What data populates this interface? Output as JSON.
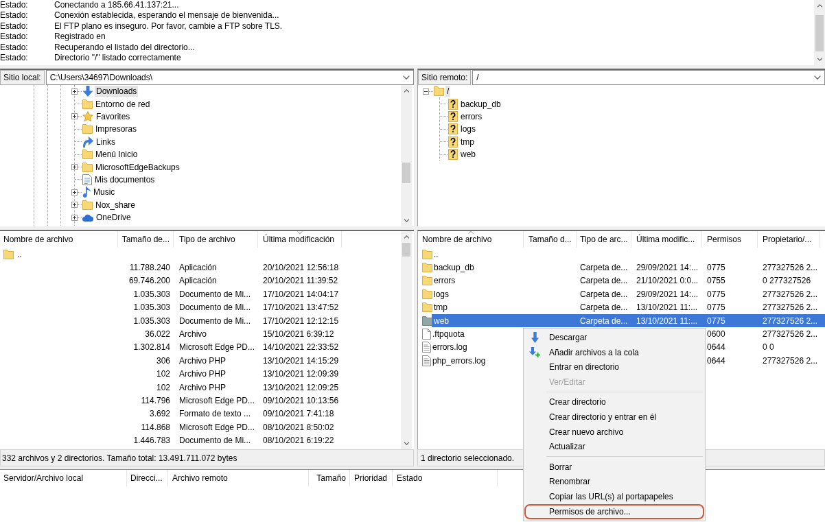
{
  "log": {
    "entries": [
      {
        "label": "Estado:",
        "message": "Conectando a 185.66.41.137:21..."
      },
      {
        "label": "Estado:",
        "message": "Conexión establecida, esperando el mensaje de bienvenida..."
      },
      {
        "label": "Estado:",
        "message": "El FTP plano es inseguro. Por favor, cambie a FTP sobre TLS."
      },
      {
        "label": "Estado:",
        "message": "Registrado en"
      },
      {
        "label": "Estado:",
        "message": "Recuperando el listado del directorio..."
      },
      {
        "label": "Estado:",
        "message": "Directorio \"/\" listado correctamente"
      }
    ]
  },
  "local_site": {
    "label": "Sitio local:",
    "path": "C:\\Users\\34697\\Downloads\\"
  },
  "local_tree": {
    "items": [
      {
        "label": "Downloads",
        "kind": "downloads",
        "expandable": true,
        "expanded": false,
        "selected": true
      },
      {
        "label": "Entorno de red",
        "kind": "folder",
        "expandable": false,
        "expanded": false,
        "selected": false
      },
      {
        "label": "Favorites",
        "kind": "star",
        "expandable": true,
        "expanded": false,
        "selected": false
      },
      {
        "label": "Impresoras",
        "kind": "folder",
        "expandable": false,
        "expanded": false,
        "selected": false
      },
      {
        "label": "Links",
        "kind": "link",
        "expandable": false,
        "expanded": false,
        "selected": false
      },
      {
        "label": "Menú Inicio",
        "kind": "folder",
        "expandable": false,
        "expanded": false,
        "selected": false
      },
      {
        "label": "MicrosoftEdgeBackups",
        "kind": "folder",
        "expandable": true,
        "expanded": false,
        "selected": false
      },
      {
        "label": "Mis documentos",
        "kind": "document",
        "expandable": false,
        "expanded": false,
        "selected": false
      },
      {
        "label": "Music",
        "kind": "music",
        "expandable": true,
        "expanded": false,
        "selected": false
      },
      {
        "label": "Nox_share",
        "kind": "folder",
        "expandable": true,
        "expanded": false,
        "selected": false
      },
      {
        "label": "OneDrive",
        "kind": "cloud",
        "expandable": true,
        "expanded": false,
        "selected": false
      }
    ]
  },
  "remote_site": {
    "label": "Sitio remoto:",
    "path": "/"
  },
  "remote_tree": {
    "items": [
      {
        "label": "/",
        "kind": "folder",
        "expandable": true,
        "expanded": true,
        "selected": true,
        "children": [
          {
            "label": "backup_db",
            "kind": "unknown",
            "expandable": false,
            "expanded": false,
            "selected": false
          },
          {
            "label": "errors",
            "kind": "unknown",
            "expandable": false,
            "expanded": false,
            "selected": false
          },
          {
            "label": "logs",
            "kind": "unknown",
            "expandable": false,
            "expanded": false,
            "selected": false
          },
          {
            "label": "tmp",
            "kind": "unknown",
            "expandable": false,
            "expanded": false,
            "selected": false
          },
          {
            "label": "web",
            "kind": "unknown",
            "expandable": false,
            "expanded": false,
            "selected": false
          }
        ]
      }
    ]
  },
  "local_files": {
    "columns": [
      {
        "label": "Nombre de archivo",
        "sort_up": false,
        "sort_down": false
      },
      {
        "label": "Tamaño de...",
        "sort_up": false,
        "sort_down": false
      },
      {
        "label": "Tipo de archivo",
        "sort_up": false,
        "sort_down": false
      },
      {
        "label": "Última modificación",
        "sort_up": false,
        "sort_down": true
      }
    ],
    "rows": [
      {
        "kind": "parent",
        "name": "..",
        "selected": false
      },
      {
        "kind": "blank",
        "size": "11.788.240",
        "type": "Aplicación",
        "modified": "20/10/2021 12:56:18",
        "selected": false
      },
      {
        "kind": "blank",
        "size": "69.746.200",
        "type": "Aplicación",
        "modified": "20/10/2021 11:39:52",
        "selected": false
      },
      {
        "kind": "blank",
        "size": "1.035.303",
        "type": "Documento de Mi...",
        "modified": "17/10/2021 14:04:17",
        "selected": false
      },
      {
        "kind": "blank",
        "size": "1.035.303",
        "type": "Documento de Mi...",
        "modified": "17/10/2021 13:47:52",
        "selected": false
      },
      {
        "kind": "blank",
        "size": "1.035.303",
        "type": "Documento de Mi...",
        "modified": "17/10/2021 12:12:15",
        "selected": false
      },
      {
        "kind": "blank",
        "size": "36.022",
        "type": "Archivo",
        "modified": "15/10/2021 6:39:12",
        "selected": false
      },
      {
        "kind": "blank",
        "size": "1.302.814",
        "type": "Microsoft Edge PD...",
        "modified": "14/10/2021 22:33:52",
        "selected": false
      },
      {
        "kind": "blank",
        "size": "306",
        "type": "Archivo PHP",
        "modified": "13/10/2021 14:15:29",
        "selected": false
      },
      {
        "kind": "blank",
        "size": "102",
        "type": "Archivo PHP",
        "modified": "13/10/2021 12:09:39",
        "selected": false
      },
      {
        "kind": "blank",
        "size": "102",
        "type": "Archivo PHP",
        "modified": "13/10/2021 12:09:25",
        "selected": false
      },
      {
        "kind": "blank",
        "size": "114.796",
        "type": "Microsoft Edge PD...",
        "modified": "09/10/2021 10:13:56",
        "selected": false
      },
      {
        "kind": "blank",
        "size": "3.692",
        "type": "Formato de texto ...",
        "modified": "09/10/2021 7:41:18",
        "selected": false
      },
      {
        "kind": "blank",
        "size": "114.868",
        "type": "Microsoft Edge PD...",
        "modified": "08/10/2021 8:50:02",
        "selected": false
      },
      {
        "kind": "blank",
        "size": "1.446.783",
        "type": "Documento de Mi...",
        "modified": "08/10/2021 6:19:22",
        "selected": false
      }
    ],
    "status": "332 archivos y 2 directorios. Tamaño total: 13.491.711.072 bytes"
  },
  "remote_files": {
    "columns": [
      {
        "label": "Nombre de archivo",
        "sort_up": true,
        "sort_down": false
      },
      {
        "label": "Tamaño d...",
        "sort_up": false,
        "sort_down": false
      },
      {
        "label": "Tipo de arc...",
        "sort_up": false,
        "sort_down": false
      },
      {
        "label": "Última modific...",
        "sort_up": false,
        "sort_down": false
      },
      {
        "label": "Permisos",
        "sort_up": false,
        "sort_down": false
      },
      {
        "label": "Propietario/...",
        "sort_up": false,
        "sort_down": false
      }
    ],
    "rows": [
      {
        "kind": "parent",
        "name": "..",
        "selected": false
      },
      {
        "kind": "folder",
        "name": "backup_db",
        "type": "Carpeta de...",
        "modified": "29/09/2021 14:...",
        "permissions": "0775",
        "owner": "277327526 2...",
        "selected": false
      },
      {
        "kind": "folder",
        "name": "errors",
        "type": "Carpeta de...",
        "modified": "21/10/2021 0:0...",
        "permissions": "0755",
        "owner": "0 277327526",
        "selected": false
      },
      {
        "kind": "folder",
        "name": "logs",
        "type": "Carpeta de...",
        "modified": "29/09/2021 14:...",
        "permissions": "0775",
        "owner": "277327526 2...",
        "selected": false
      },
      {
        "kind": "folder",
        "name": "tmp",
        "type": "Carpeta de...",
        "modified": "13/10/2021 11:...",
        "permissions": "0775",
        "owner": "277327526 2...",
        "selected": false
      },
      {
        "kind": "folder",
        "name": "web",
        "type": "Carpeta de...",
        "modified": "13/10/2021 11:...",
        "permissions": "0775",
        "owner": "277327526 2...",
        "selected": true
      },
      {
        "kind": "file",
        "name": ".ftpquota",
        "permissions": "0600",
        "owner": "277327526 2...",
        "selected": false
      },
      {
        "kind": "textfile",
        "name": "errors.log",
        "permissions": "0644",
        "owner": "0 0",
        "selected": false
      },
      {
        "kind": "textfile",
        "name": "php_errors.log",
        "permissions": "0644",
        "owner": "277327526 2...",
        "selected": false
      }
    ],
    "status": "1 directorio seleccionado."
  },
  "queue": {
    "columns": [
      "Servidor/Archivo local",
      "Direcci...",
      "Archivo remoto",
      "Tamaño",
      "Prioridad",
      "Estado"
    ]
  },
  "context_menu": {
    "sections": [
      [
        {
          "label": "Descargar",
          "kind": "download",
          "disabled": false,
          "highlighted": false
        },
        {
          "label": "Añadir archivos a la cola",
          "kind": "enqueue",
          "disabled": false,
          "highlighted": false
        },
        {
          "label": "Entrar en directorio",
          "kind": "plain",
          "disabled": false,
          "highlighted": false
        },
        {
          "label": "Ver/Editar",
          "kind": "plain",
          "disabled": true,
          "highlighted": false
        }
      ],
      [
        {
          "label": "Crear directorio",
          "kind": "plain",
          "disabled": false,
          "highlighted": false
        },
        {
          "label": "Crear directorio y entrar en él",
          "kind": "plain",
          "disabled": false,
          "highlighted": false
        },
        {
          "label": "Crear nuevo archivo",
          "kind": "plain",
          "disabled": false,
          "highlighted": false
        },
        {
          "label": "Actualizar",
          "kind": "plain",
          "disabled": false,
          "highlighted": false
        }
      ],
      [
        {
          "label": "Borrar",
          "kind": "plain",
          "disabled": false,
          "highlighted": false
        },
        {
          "label": "Renombrar",
          "kind": "plain",
          "disabled": false,
          "highlighted": false
        },
        {
          "label": "Copiar las URL(s) al portapapeles",
          "kind": "plain",
          "disabled": false,
          "highlighted": false
        },
        {
          "label": "Permisos de archivo...",
          "kind": "plain",
          "disabled": false,
          "highlighted": true
        }
      ]
    ]
  }
}
